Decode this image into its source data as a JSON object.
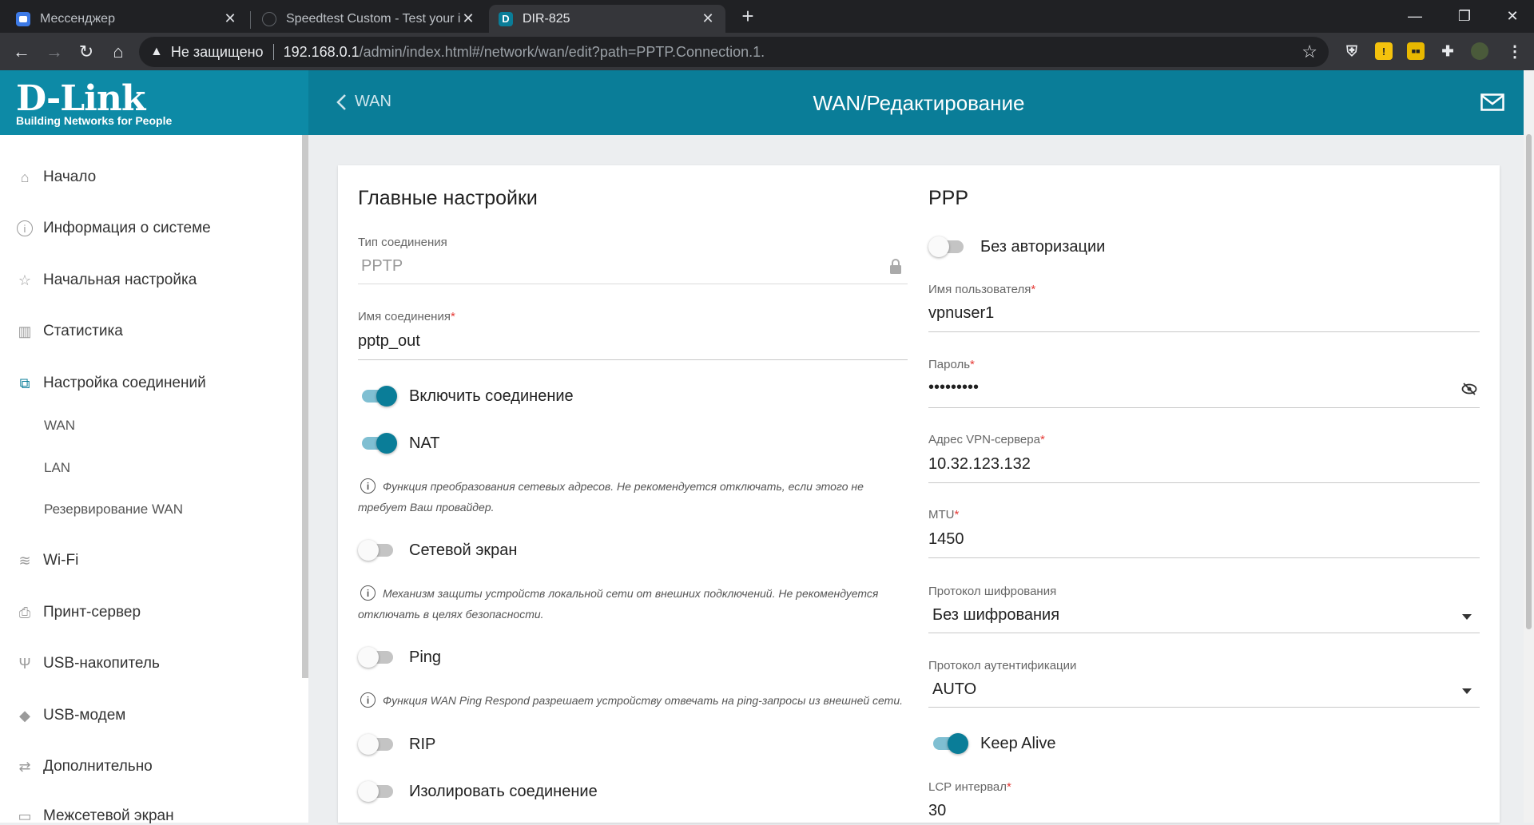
{
  "browser": {
    "tabs": [
      {
        "title": "Мессенджер"
      },
      {
        "title": "Speedtest Custom - Test your internet"
      },
      {
        "title": "DIR-825"
      }
    ],
    "security_label": "Не защищено",
    "url_host": "192.168.0.1",
    "url_path": "/admin/index.html#/network/wan/edit?path=PPTP.Connection.1."
  },
  "header": {
    "logo_main": "D-Link",
    "logo_sub": "Building Networks for People",
    "back_label": "WAN",
    "title": "WAN/Редактирование"
  },
  "sidebar": {
    "items": [
      {
        "label": "Начало",
        "icon": "home-icon"
      },
      {
        "label": "Информация о системе",
        "icon": "info-icon"
      },
      {
        "label": "Начальная настройка",
        "icon": "star-icon"
      },
      {
        "label": "Статистика",
        "icon": "chart-icon"
      },
      {
        "label": "Настройка соединений",
        "icon": "network-icon"
      },
      {
        "label": "Wi-Fi",
        "icon": "wifi-icon"
      },
      {
        "label": "Принт-сервер",
        "icon": "printer-icon"
      },
      {
        "label": "USB-накопитель",
        "icon": "usb-icon"
      },
      {
        "label": "USB-модем",
        "icon": "modem-icon"
      },
      {
        "label": "Дополнительно",
        "icon": "arrows-icon"
      },
      {
        "label": "Межсетевой экран",
        "icon": "firewall-icon"
      }
    ],
    "sub_items": [
      "WAN",
      "LAN",
      "Резервирование WAN"
    ]
  },
  "main": {
    "section_title": "Главные настройки",
    "conn_type_label": "Тип соединения",
    "conn_type_value": "PPTP",
    "conn_name_label": "Имя соединения",
    "conn_name_value": "pptp_out",
    "enable_label": "Включить соединение",
    "enable_on": true,
    "nat_label": "NAT",
    "nat_on": true,
    "nat_hint_1": "Функция преобразования сетевых адресов. Не рекомендуется отключать, если этого не",
    "nat_hint_2": "требует Ваш провайдер.",
    "firewall_label": "Сетевой экран",
    "firewall_on": false,
    "firewall_hint_1": "Механизм защиты устройств локальной сети от внешних подключений. Не рекомендуется",
    "firewall_hint_2": "отключать в целях безопасности.",
    "ping_label": "Ping",
    "ping_on": false,
    "ping_hint": "Функция WAN Ping Respond разрешает устройству отвечать на ping-запросы из внешней сети.",
    "rip_label": "RIP",
    "rip_on": false,
    "isolate_label": "Изолировать соединение",
    "isolate_on": false
  },
  "ppp": {
    "section_title": "PPP",
    "noauth_label": "Без авторизации",
    "noauth_on": false,
    "username_label": "Имя пользователя",
    "username_value": "vpnuser1",
    "password_label": "Пароль",
    "password_value": "•••••••••",
    "server_label": "Адрес VPN-сервера",
    "server_value": "10.32.123.132",
    "mtu_label": "MTU",
    "mtu_value": "1450",
    "encryption_label": "Протокол шифрования",
    "encryption_value": "Без шифрования",
    "auth_label": "Протокол аутентификации",
    "auth_value": "AUTO",
    "keepalive_label": "Keep Alive",
    "keepalive_on": true,
    "lcp_label": "LCP интервал",
    "lcp_value": "30"
  },
  "required_mark": "*"
}
